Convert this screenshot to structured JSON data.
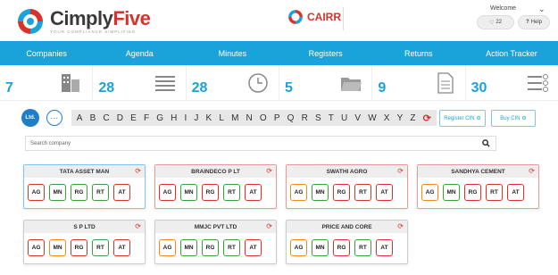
{
  "header": {
    "brand_first": "Cimply",
    "brand_second": "Five",
    "tagline": "YOUR COMPLIANCE SIMPLIFIED",
    "cairr": "CAIRR",
    "welcome": "Welcome",
    "notif_count": "22",
    "help_label": "Help",
    "icons": {
      "logo": "cimplyfive-logo",
      "cairr": "cairr-logo",
      "bell": "bell-icon",
      "help": "question-icon",
      "chevron": "chevron-down-icon"
    }
  },
  "nav": {
    "items": [
      "Companies",
      "Agenda",
      "Minutes",
      "Registers",
      "Returns",
      "Action Tracker"
    ]
  },
  "stats": [
    {
      "value": "7",
      "icon": "building-icon"
    },
    {
      "value": "28",
      "icon": "list-icon"
    },
    {
      "value": "28",
      "icon": "clock-icon"
    },
    {
      "value": "5",
      "icon": "folder-icon"
    },
    {
      "value": "9",
      "icon": "document-icon"
    },
    {
      "value": "30",
      "icon": "settings-list-icon"
    }
  ],
  "filter": {
    "ltd_label": "Ltd.",
    "more_label": "···",
    "letters": [
      "A",
      "B",
      "C",
      "D",
      "E",
      "F",
      "G",
      "H",
      "I",
      "J",
      "K",
      "L",
      "M",
      "N",
      "O",
      "P",
      "Q",
      "R",
      "S",
      "T",
      "U",
      "V",
      "W",
      "X",
      "Y",
      "Z"
    ]
  },
  "buttons": {
    "register_cin": "Register CIN",
    "buy_cin": "Buy CIN"
  },
  "search": {
    "placeholder": "Search company"
  },
  "colors": {
    "accent": "#1aa3db",
    "brand_red": "#d9322a",
    "red": "#d9322a",
    "green": "#3aa13a",
    "orange": "#ef8a1e",
    "blue": "#1aa3db"
  },
  "companies": [
    {
      "name": "TATA ASSET MAN",
      "border": "#7cc7ef",
      "codes": [
        {
          "c": "AG",
          "s": "red"
        },
        {
          "c": "MN",
          "s": "green"
        },
        {
          "c": "RG",
          "s": "green"
        },
        {
          "c": "RT",
          "s": "green"
        },
        {
          "c": "AT",
          "s": "red"
        }
      ]
    },
    {
      "name": "BRAINDECO P LT",
      "border": "#e89a9a",
      "codes": [
        {
          "c": "AG",
          "s": "red"
        },
        {
          "c": "MN",
          "s": "green"
        },
        {
          "c": "RG",
          "s": "red"
        },
        {
          "c": "RT",
          "s": "green"
        },
        {
          "c": "AT",
          "s": "red"
        }
      ]
    },
    {
      "name": "SWATHI AGRO",
      "border": "#e89a9a",
      "codes": [
        {
          "c": "AG",
          "s": "orange"
        },
        {
          "c": "MN",
          "s": "green"
        },
        {
          "c": "RG",
          "s": "red"
        },
        {
          "c": "RT",
          "s": "red"
        },
        {
          "c": "AT",
          "s": "red"
        }
      ]
    },
    {
      "name": "SANDHYA CEMENT",
      "border": "#e89a9a",
      "codes": [
        {
          "c": "AG",
          "s": "orange"
        },
        {
          "c": "MN",
          "s": "green"
        },
        {
          "c": "RG",
          "s": "red"
        },
        {
          "c": "RT",
          "s": "red"
        },
        {
          "c": "AT",
          "s": "red"
        }
      ]
    },
    {
      "name": "S P LTD",
      "border": "#ccc",
      "codes": [
        {
          "c": "AG",
          "s": "red"
        },
        {
          "c": "MN",
          "s": "orange"
        },
        {
          "c": "RG",
          "s": "red"
        },
        {
          "c": "RT",
          "s": "green"
        },
        {
          "c": "AT",
          "s": "red"
        }
      ]
    },
    {
      "name": "MMJC PVT LTD",
      "border": "#ccc",
      "codes": [
        {
          "c": "AG",
          "s": "orange"
        },
        {
          "c": "MN",
          "s": "green"
        },
        {
          "c": "RG",
          "s": "green"
        },
        {
          "c": "RT",
          "s": "green"
        },
        {
          "c": "AT",
          "s": "red"
        }
      ]
    },
    {
      "name": "PRICE AND CORE",
      "border": "#ccc",
      "codes": [
        {
          "c": "AG",
          "s": "orange"
        },
        {
          "c": "MN",
          "s": "green"
        },
        {
          "c": "RG",
          "s": "red"
        },
        {
          "c": "RT",
          "s": "green"
        },
        {
          "c": "AT",
          "s": "red"
        }
      ]
    }
  ]
}
